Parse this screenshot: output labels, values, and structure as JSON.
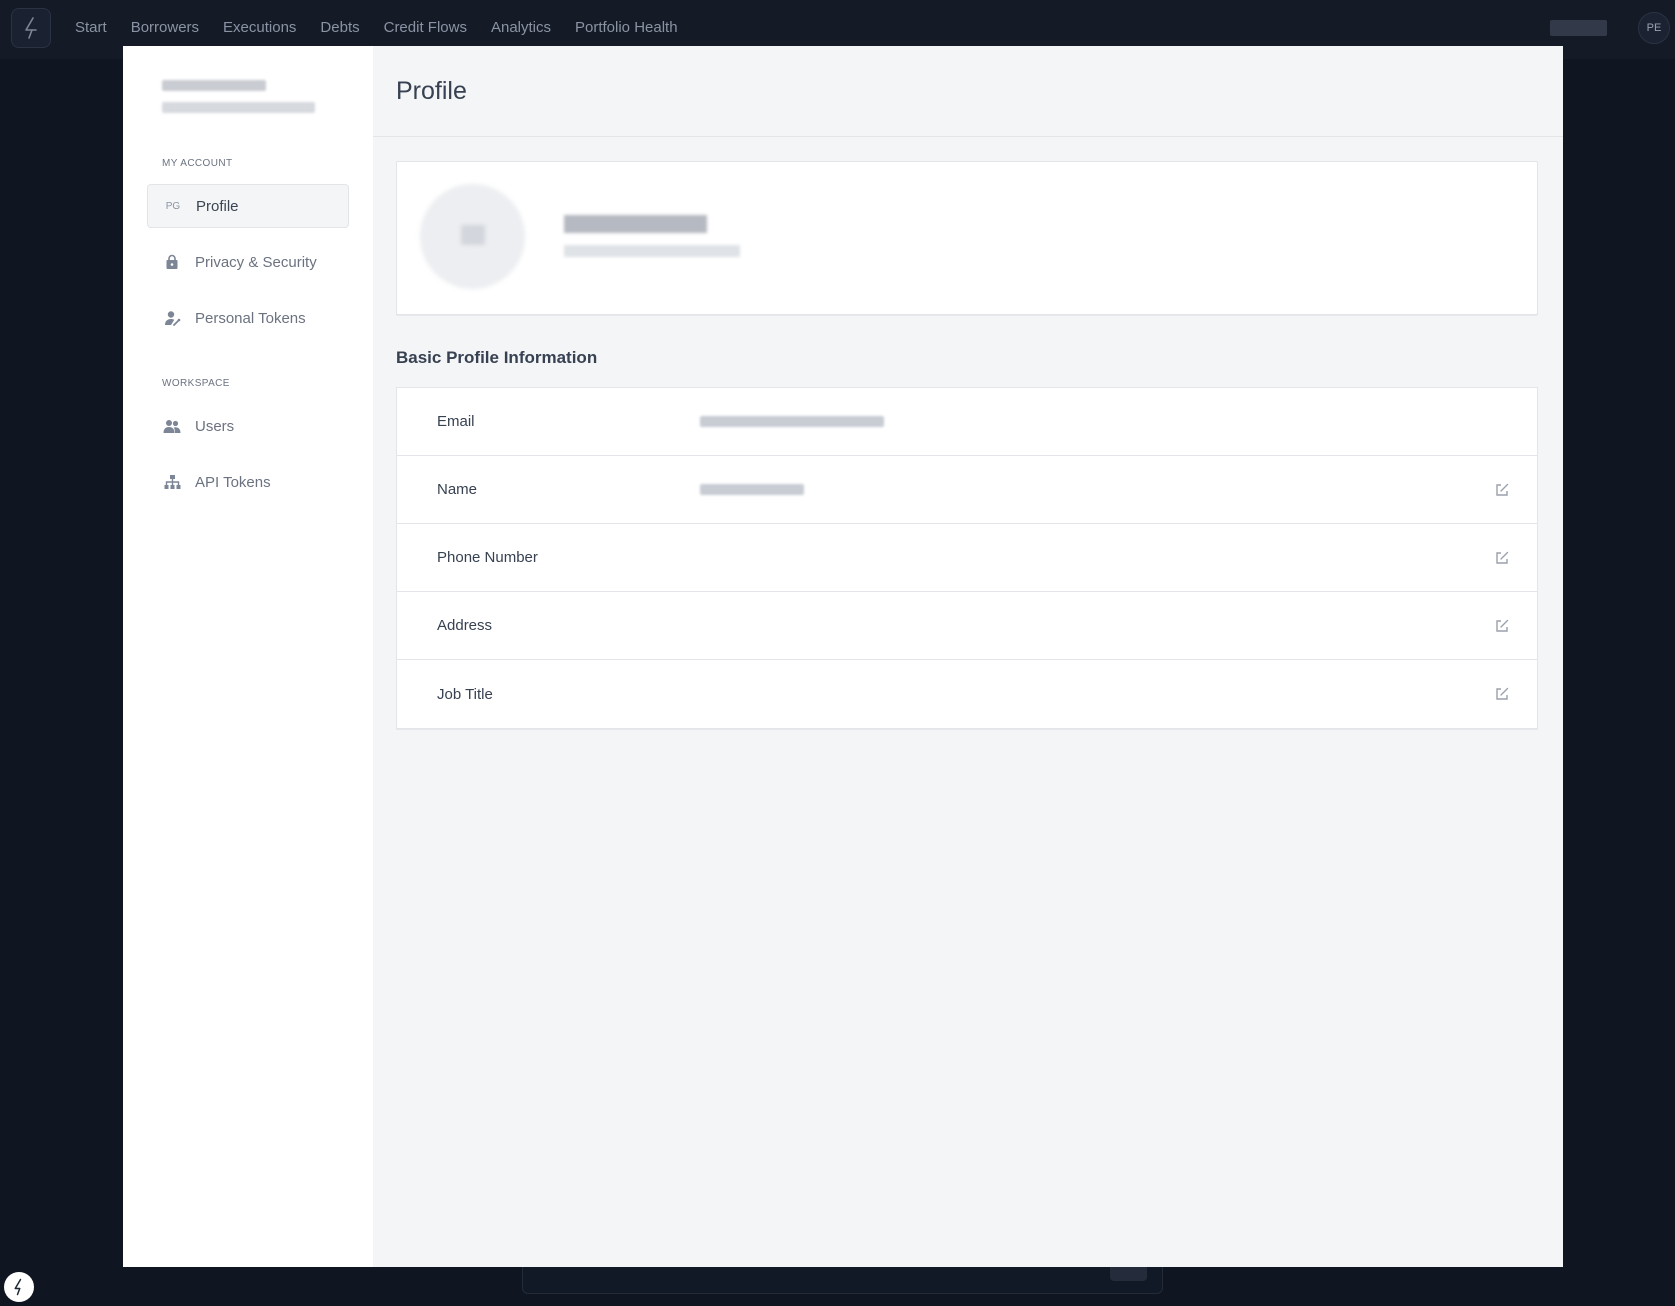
{
  "nav": {
    "links": [
      "Start",
      "Borrowers",
      "Executions",
      "Debts",
      "Credit Flows",
      "Analytics",
      "Portfolio Health"
    ],
    "avatar_initials": "PE"
  },
  "sidebar": {
    "section_my_account": "MY ACCOUNT",
    "section_workspace": "WORKSPACE",
    "items": [
      {
        "label": "Profile",
        "icon": "PG"
      },
      {
        "label": "Privacy & Security",
        "icon": "lock-icon"
      },
      {
        "label": "Personal Tokens",
        "icon": "user-key-icon"
      },
      {
        "label": "Users",
        "icon": "users-icon"
      },
      {
        "label": "API Tokens",
        "icon": "sitemap-icon"
      }
    ]
  },
  "main": {
    "title": "Profile",
    "section_heading": "Basic Profile Information",
    "fields": [
      {
        "label": "Email"
      },
      {
        "label": "Name"
      },
      {
        "label": "Phone Number"
      },
      {
        "label": "Address"
      },
      {
        "label": "Job Title"
      }
    ]
  },
  "colors": {
    "nav_bg": "#141b27",
    "overlay_bg": "#0f1521",
    "modal_bg": "#f4f5f7",
    "text_primary": "#374151",
    "text_muted": "#6b7280"
  }
}
